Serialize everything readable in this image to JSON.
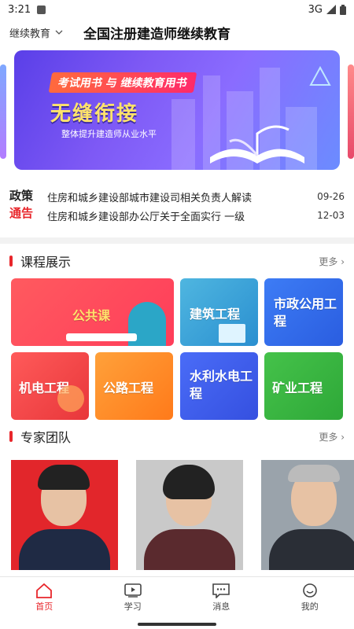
{
  "status_bar": {
    "time": "3:21",
    "network": "3G"
  },
  "header": {
    "selector_label": "继续教育",
    "title": "全国注册建造师继续教育"
  },
  "banner": {
    "tag_text": "考试用书 与 继续教育用书",
    "headline": "无缝衔接",
    "subtitle": "整体提升建造师从业水平"
  },
  "notice": {
    "logo_line1": "政策",
    "logo_line2": "通告",
    "items": [
      {
        "title": "住房和城乡建设部城市建设司相关负责人解读",
        "date": "09-26"
      },
      {
        "title": "住房和城乡建设部办公厅关于全面实行 一级",
        "date": "12-03"
      }
    ]
  },
  "courses": {
    "title": "课程展示",
    "more": "更多",
    "items": [
      {
        "label": "公共课"
      },
      {
        "label": "建筑工程"
      },
      {
        "label": "市政公用工程"
      },
      {
        "label": "机电工程"
      },
      {
        "label": "公路工程"
      },
      {
        "label": "水利水电工程"
      },
      {
        "label": "矿业工程"
      }
    ]
  },
  "experts": {
    "title": "专家团队",
    "more": "更多"
  },
  "tabbar": {
    "items": [
      {
        "label": "首页"
      },
      {
        "label": "学习"
      },
      {
        "label": "消息"
      },
      {
        "label": "我的"
      }
    ]
  },
  "colors": {
    "accent": "#e8262b"
  }
}
